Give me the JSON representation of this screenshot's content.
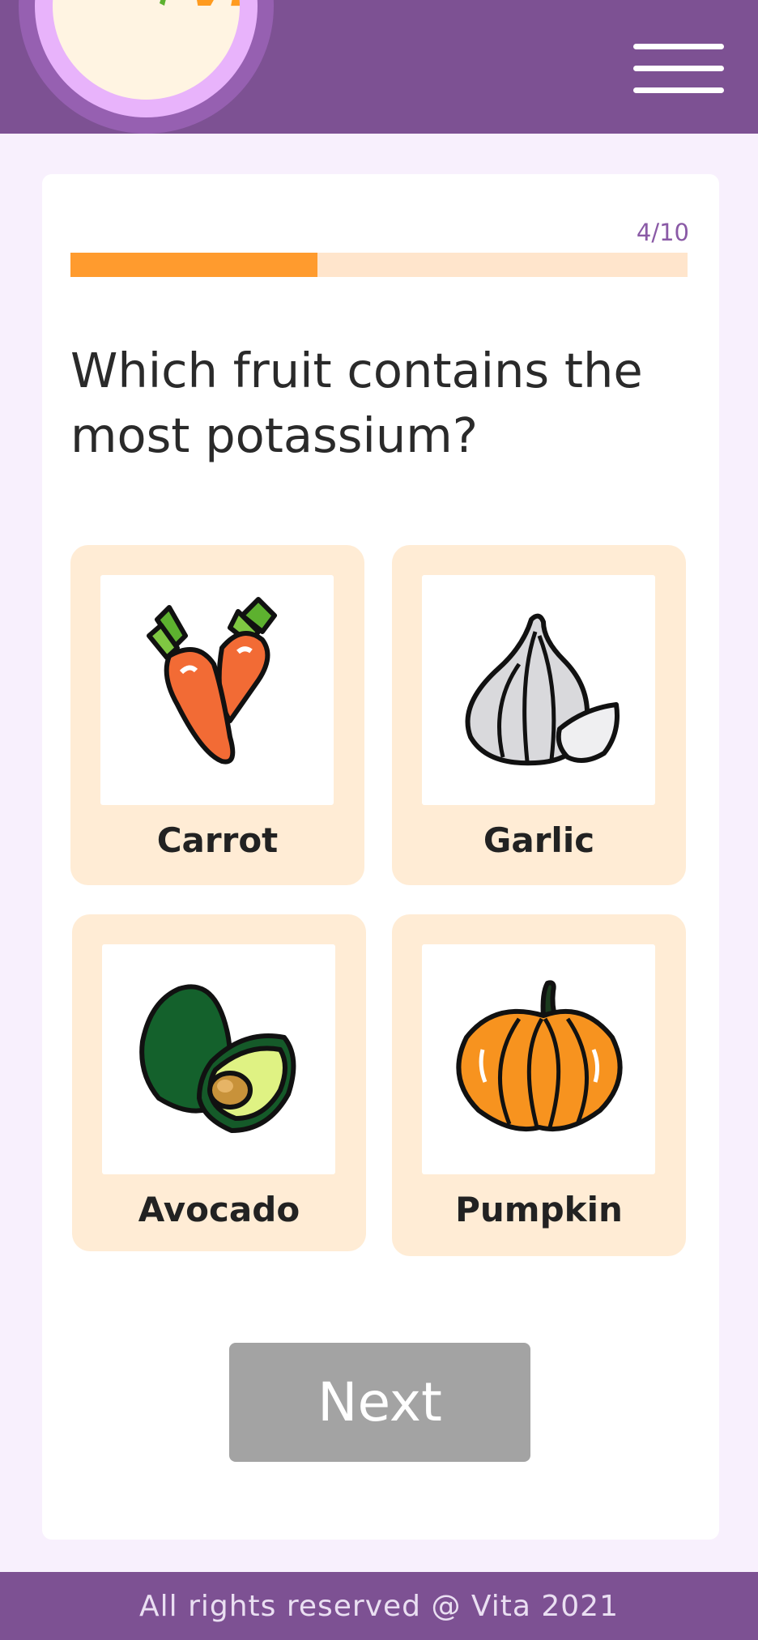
{
  "app": {
    "logo_text": "Vita",
    "brand_colors": {
      "header": "#7d5193",
      "accent": "#ff9b2e",
      "leaf": "#5db12f"
    }
  },
  "header": {
    "menu_icon": "hamburger-menu-icon"
  },
  "quiz": {
    "progress_text": "4/10",
    "progress_fraction": 0.4,
    "question": "Which fruit contains the most potassium?",
    "options": [
      {
        "label": "Carrot",
        "icon": "carrot-icon"
      },
      {
        "label": "Garlic",
        "icon": "garlic-icon"
      },
      {
        "label": "Avocado",
        "icon": "avocado-icon"
      },
      {
        "label": "Pumpkin",
        "icon": "pumpkin-icon"
      }
    ],
    "next_label": "Next"
  },
  "footer": {
    "text": "All rights reserved @ Vita 2021"
  }
}
